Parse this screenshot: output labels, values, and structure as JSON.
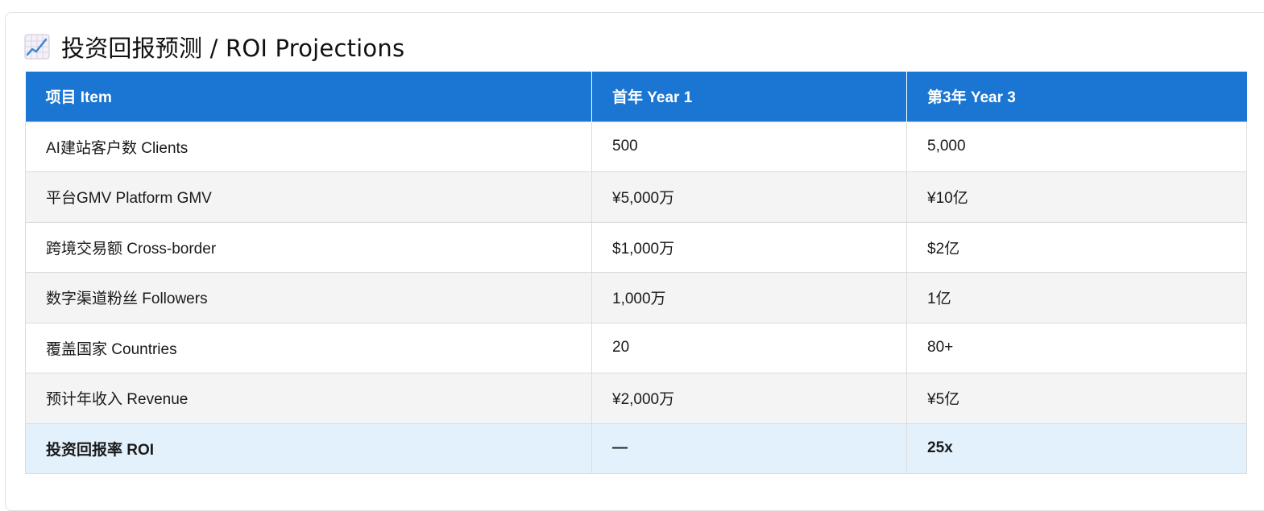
{
  "title": {
    "icon": "chart-increasing-icon",
    "text": "投资回报预测 / ROI Projections"
  },
  "colors": {
    "header_bg": "#1a76d2",
    "header_text": "#ffffff",
    "row_alt_bg": "#f4f4f4",
    "total_row_bg": "#e3f1fc"
  },
  "table": {
    "headers": [
      "项目 Item",
      "首年 Year 1",
      "第3年 Year 3"
    ],
    "rows": [
      [
        "AI建站客户数 Clients",
        "500",
        "5,000"
      ],
      [
        "平台GMV Platform GMV",
        "¥5,000万",
        "¥10亿"
      ],
      [
        "跨境交易额 Cross-border",
        "$1,000万",
        "$2亿"
      ],
      [
        "数字渠道粉丝 Followers",
        "1,000万",
        "1亿"
      ],
      [
        "覆盖国家 Countries",
        "20",
        "80+"
      ],
      [
        "预计年收入 Revenue",
        "¥2,000万",
        "¥5亿"
      ]
    ],
    "total_row": [
      "投资回报率 ROI",
      "—",
      "25x"
    ]
  }
}
